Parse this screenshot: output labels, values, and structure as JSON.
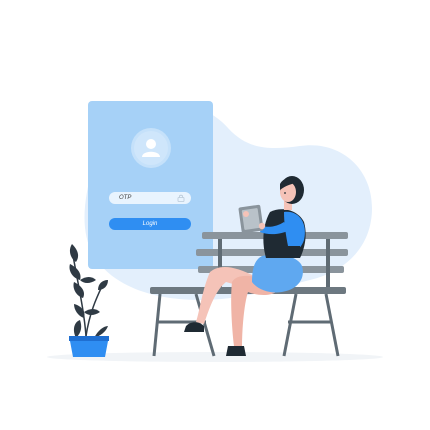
{
  "login_form": {
    "otp_placeholder": "OTP",
    "login_label": "Login"
  },
  "icons": {
    "avatar": "user-avatar-icon",
    "lock": "lock-icon"
  },
  "colors": {
    "blob": "#e3effc",
    "card": "#a6d1f7",
    "button": "#2f8ef2",
    "bench": "#5f6b74",
    "shirt": "#2f8ef2",
    "plant_pot": "#2f8ef2",
    "hair": "#1f2a33"
  }
}
